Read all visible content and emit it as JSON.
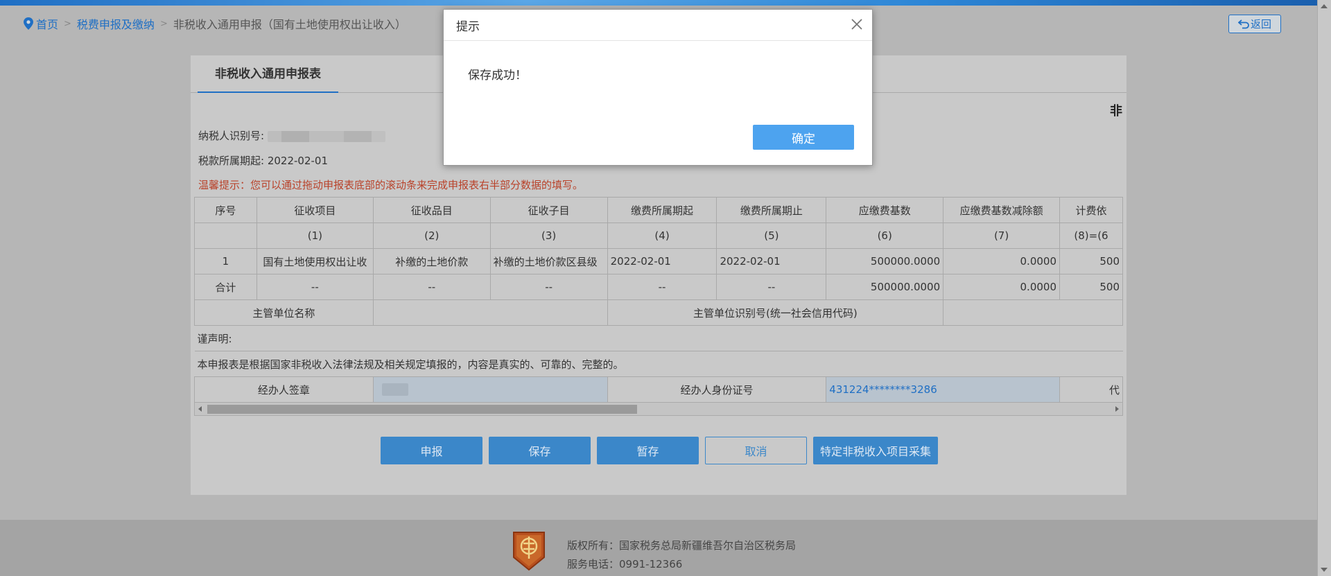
{
  "breadcrumb": {
    "home": "首页",
    "level2": "税费申报及缴纳",
    "separator": ">",
    "current": "非税收入通用申报（国有土地使用权出让收入）"
  },
  "back_label": "返回",
  "tab_label": "非税收入通用申报表",
  "form_title_fragment": "非",
  "fields": {
    "taxpayer_id_label": "纳税人识别号:",
    "period_start_label": "税款所属期起:",
    "period_start_value": "2022-02-01"
  },
  "tip": "温馨提示：您可以通过拖动申报表底部的滚动条来完成申报表右半部分数据的填写。",
  "table": {
    "headers": [
      "序号",
      "征收项目",
      "征收品目",
      "征收子目",
      "缴费所属期起",
      "缴费所属期止",
      "应缴费基数",
      "应缴费基数减除额",
      "计费依"
    ],
    "codes": [
      "",
      "(1)",
      "(2)",
      "(3)",
      "(4)",
      "(5)",
      "(6)",
      "(7)",
      "(8)=(6"
    ],
    "row1": [
      "1",
      "国有土地使用权出让收",
      "补缴的土地价款",
      "补缴的土地价款区县级",
      "2022-02-01",
      "2022-02-01",
      "500000.0000",
      "0.0000",
      "500"
    ],
    "total": [
      "合计",
      "--",
      "--",
      "--",
      "--",
      "--",
      "500000.0000",
      "0.0000",
      "500"
    ],
    "authority_name_label": "主管单位名称",
    "authority_id_label": "主管单位识别号(统一社会信用代码)",
    "declaration_title": "谨声明:",
    "declaration_text": "本申报表是根据国家非税收入法律法规及相关规定填报的，内容是真实的、可靠的、完整的。",
    "agent_sign_label": "经办人签章",
    "agent_id_label": "经办人身份证号",
    "agent_id_value": "431224********3286",
    "agent_trunc": "代"
  },
  "buttons": {
    "declare": "申报",
    "save": "保存",
    "draft": "暂存",
    "cancel": "取消",
    "special": "特定非税收入项目采集"
  },
  "footer": {
    "copyright": "版权所有：国家税务总局新疆维吾尔自治区税务局",
    "phone": "服务电话：0991-12366"
  },
  "modal": {
    "title": "提示",
    "message": "保存成功！",
    "ok": "确定"
  },
  "colors": {
    "primary": "#3b87c9",
    "link": "#1f6fc4",
    "tip_red": "#b9422a",
    "modal_button": "#4da3ef"
  }
}
